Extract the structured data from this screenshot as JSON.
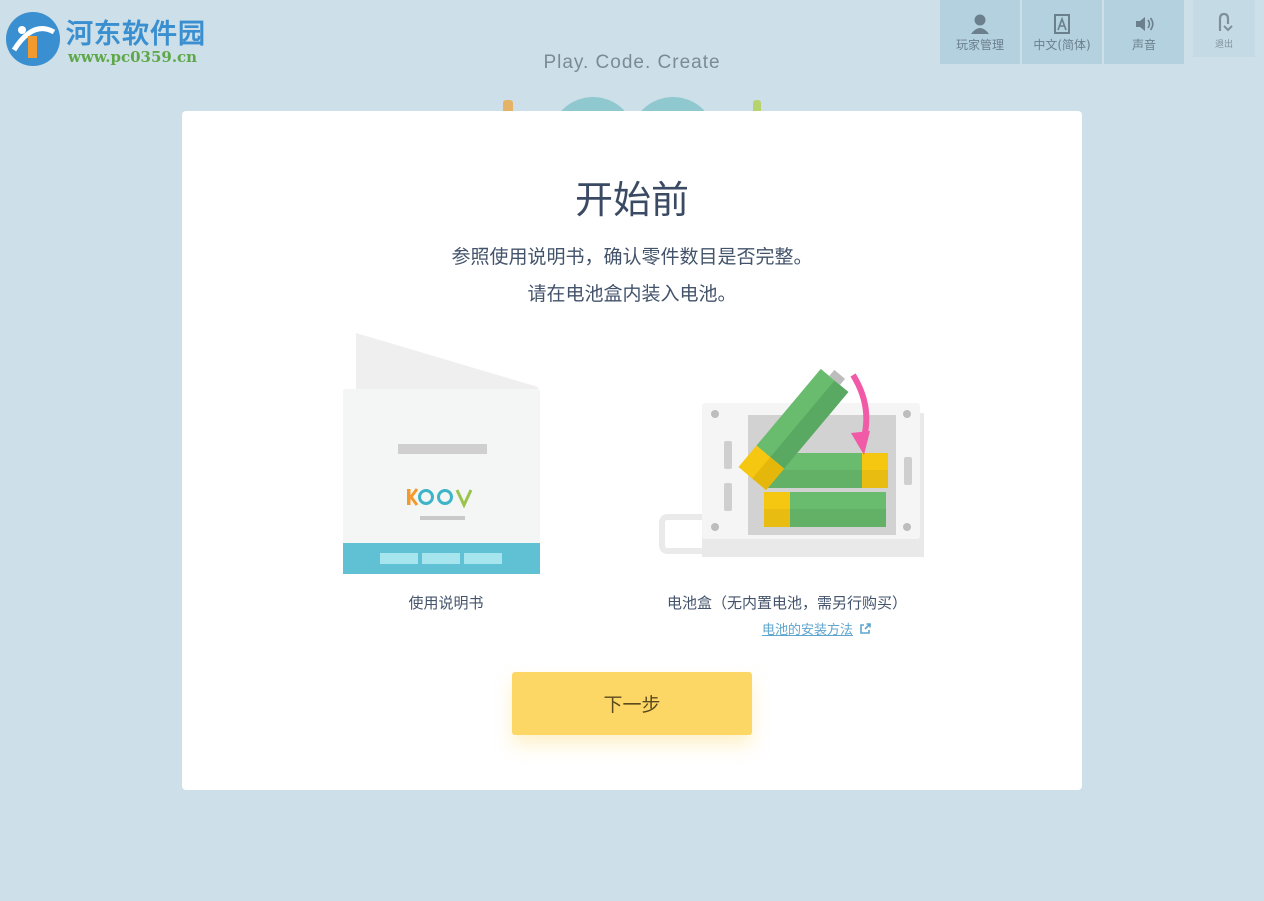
{
  "watermark": {
    "title": "河东软件园",
    "url": "www.pc0359.cn"
  },
  "header": {
    "tagline": "Play. Code. Create"
  },
  "toolbar": {
    "player_label": "玩家管理",
    "language_label": "中文(简体)",
    "sound_label": "声音",
    "exit_label": "退出"
  },
  "card": {
    "title": "开始前",
    "desc_line1": "参照使用说明书，确认零件数目是否完整。",
    "desc_line2": "请在电池盒内装入电池。",
    "manual_caption": "使用说明书",
    "battery_caption": "电池盒（无内置电池，需另行购买）",
    "battery_help_link": "电池的安装方法",
    "next_button": "下一步"
  },
  "colors": {
    "background": "#cddfe8",
    "accent_yellow": "#fdd766",
    "link_blue": "#5ea5cf",
    "toolbar_blue": "#b4d1e0"
  }
}
